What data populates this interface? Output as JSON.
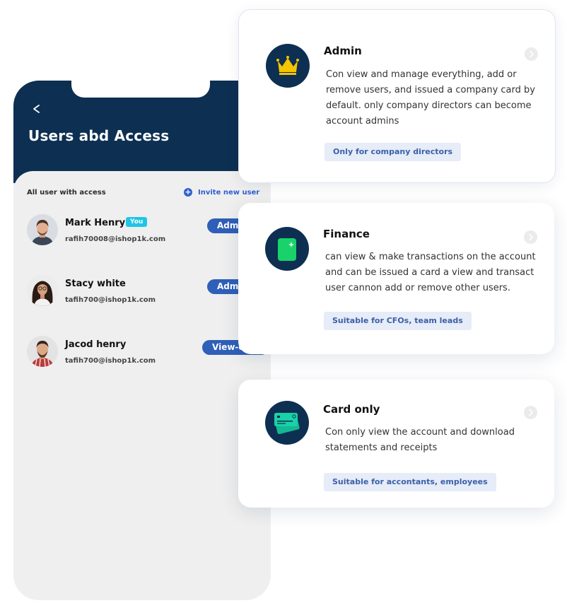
{
  "phone": {
    "title": "Users abd Access",
    "list_heading": "All user with access",
    "invite_label": "Invite new user",
    "users": [
      {
        "name": "Mark Henry",
        "badge": "You",
        "email": "rafih70008@ishop1k.com",
        "role": "Admin"
      },
      {
        "name": "Stacy white",
        "email": "tafih700@ishop1k.com",
        "role": "Admin"
      },
      {
        "name": "Jacod henry",
        "email": "tafih700@ishop1k.com",
        "role": "View-only"
      }
    ]
  },
  "roles": [
    {
      "title": "Admin",
      "description": "Con  view and manage everything, add or remove users, and issued a company card by default. only company directors can become account admins",
      "tag": "Only for company directors",
      "icon": "crown-icon"
    },
    {
      "title": "Finance",
      "description": "can view & make transactions on the account and can be issued a card a view and transact user cannon add or remove other users.",
      "tag": "Suitable for CFOs, team leads",
      "icon": "card-sparkle-icon"
    },
    {
      "title": "Card only",
      "description": "Con only view the account and download statements and receipts",
      "tag": "Suitable for accontants, employees",
      "icon": "credit-cards-icon"
    }
  ],
  "colors": {
    "navy": "#0d2f52",
    "accent_blue": "#2f5fb8",
    "badge_cyan": "#1fc6e6",
    "tag_bg": "#e6ecf8",
    "crown_gold": "#f5c400",
    "finance_green": "#19d26a"
  }
}
